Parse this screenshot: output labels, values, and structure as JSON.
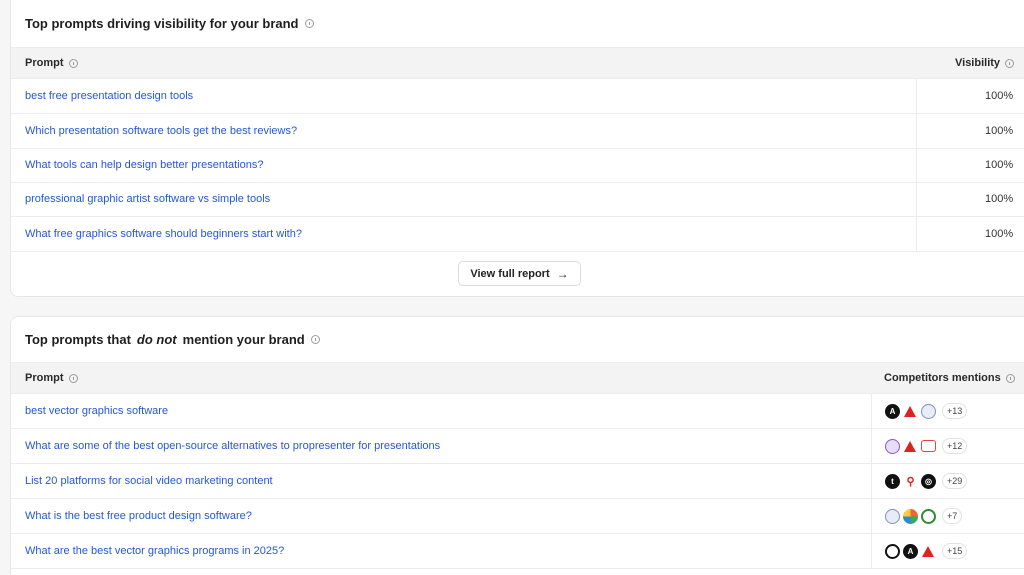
{
  "visibility_card": {
    "title": "Top prompts driving visibility for your brand",
    "col_prompt": "Prompt",
    "col_visibility": "Visibility",
    "rows": [
      {
        "prompt": "best free presentation design tools",
        "visibility": "100%"
      },
      {
        "prompt": "Which presentation software tools get the best reviews?",
        "visibility": "100%"
      },
      {
        "prompt": "What tools can help design better presentations?",
        "visibility": "100%"
      },
      {
        "prompt": "professional graphic artist software vs simple tools",
        "visibility": "100%"
      },
      {
        "prompt": "What free graphics software should beginners start with?",
        "visibility": "100%"
      }
    ],
    "view_button": "View full report",
    "view_button_icon": "arrow-right-icon"
  },
  "no_mention_card": {
    "title_pre": "Top prompts that",
    "title_em": "do not",
    "title_post": "mention your brand",
    "col_prompt": "Prompt",
    "col_competitors": "Competitors mentions",
    "rows": [
      {
        "prompt": "best vector graphics software",
        "logos": [
          "black-a-logo",
          "red-triangle-logo",
          "globe-logo"
        ],
        "more": "+13"
      },
      {
        "prompt": "What are some of the best open-source alternatives to propresenter for presentations",
        "logos": [
          "purple-circle-logo",
          "red-triangle-logo",
          "chat-bubble-logo"
        ],
        "more": "+12"
      },
      {
        "prompt": "List 20 platforms for social video marketing content",
        "logos": [
          "tumblr-logo",
          "pin-logo",
          "black-circle-logo"
        ],
        "more": "+29"
      },
      {
        "prompt": "What is the best free product design software?",
        "logos": [
          "globe-logo",
          "multicolor-logo",
          "green-ring-logo"
        ],
        "more": "+7"
      },
      {
        "prompt": "What are the best vector graphics programs in 2025?",
        "logos": [
          "ring-logo",
          "black-a-logo",
          "red-triangle-logo"
        ],
        "more": "+15"
      }
    ]
  }
}
